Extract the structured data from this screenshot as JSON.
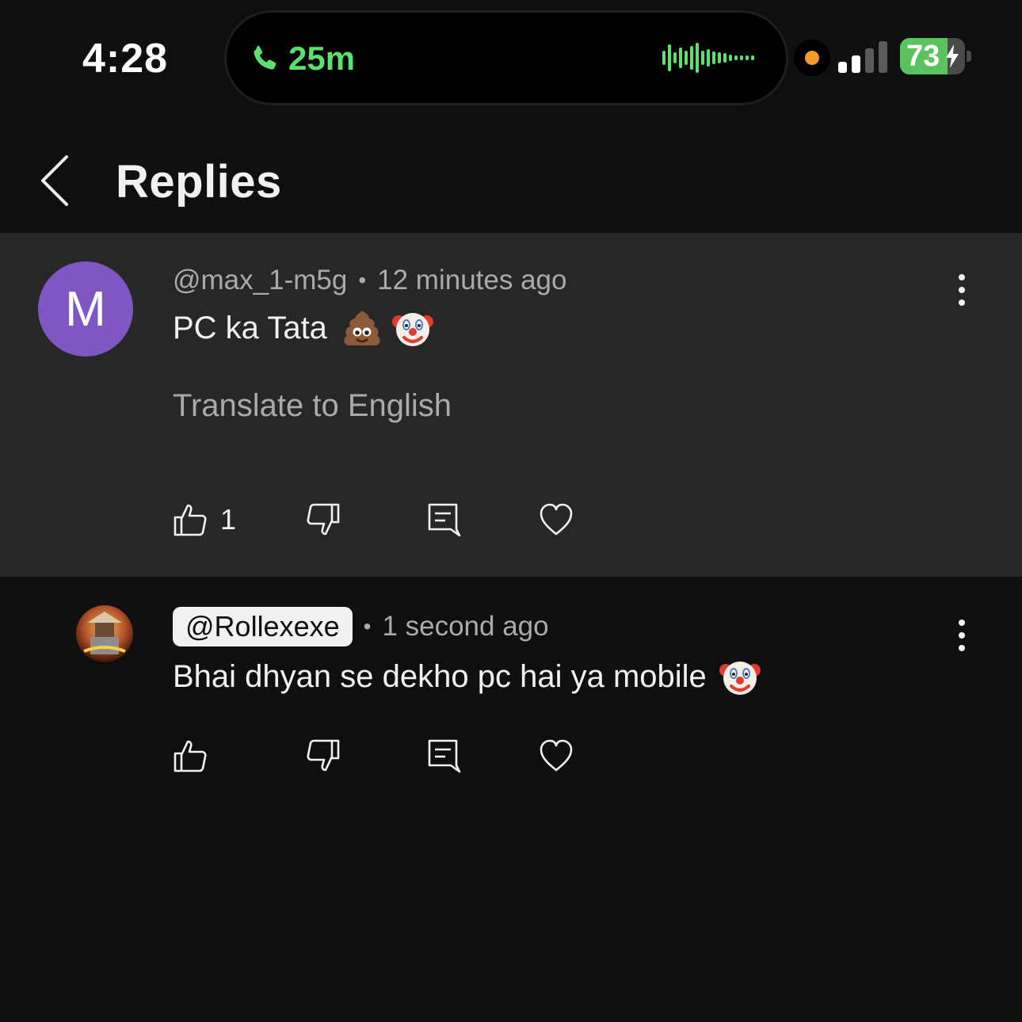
{
  "status_bar": {
    "time": "4:28",
    "call_duration": "25m",
    "battery_percent": "73",
    "battery_level": 0.73,
    "signal_bars_active": 2,
    "signal_bars_total": 4,
    "colors": {
      "call": "#5ce16f",
      "battery": "#5ac35e",
      "privacy_dot": "#f39b2b"
    }
  },
  "header": {
    "title": "Replies",
    "back_icon": "chevron-left-icon"
  },
  "comments": [
    {
      "avatar_letter": "M",
      "avatar_color": "#7e57c2",
      "handle": "@max_1-m5g",
      "separator": "•",
      "timestamp": "12 minutes ago",
      "text": "PC ka Tata",
      "emojis": [
        "poop-emoji",
        "clown-emoji"
      ],
      "translate_label": "Translate to English",
      "like_count": "1"
    },
    {
      "avatar": "channel-avatar-image",
      "handle": "@Rollexexe",
      "separator": "•",
      "timestamp": "1 second ago",
      "text": "Bhai dhyan se dekho pc hai ya mobile",
      "emojis": [
        "clown-emoji"
      ],
      "like_count": ""
    }
  ],
  "icons": [
    "thumbs-up-icon",
    "thumbs-down-icon",
    "reply-icon",
    "heart-icon",
    "more-vertical-icon"
  ]
}
